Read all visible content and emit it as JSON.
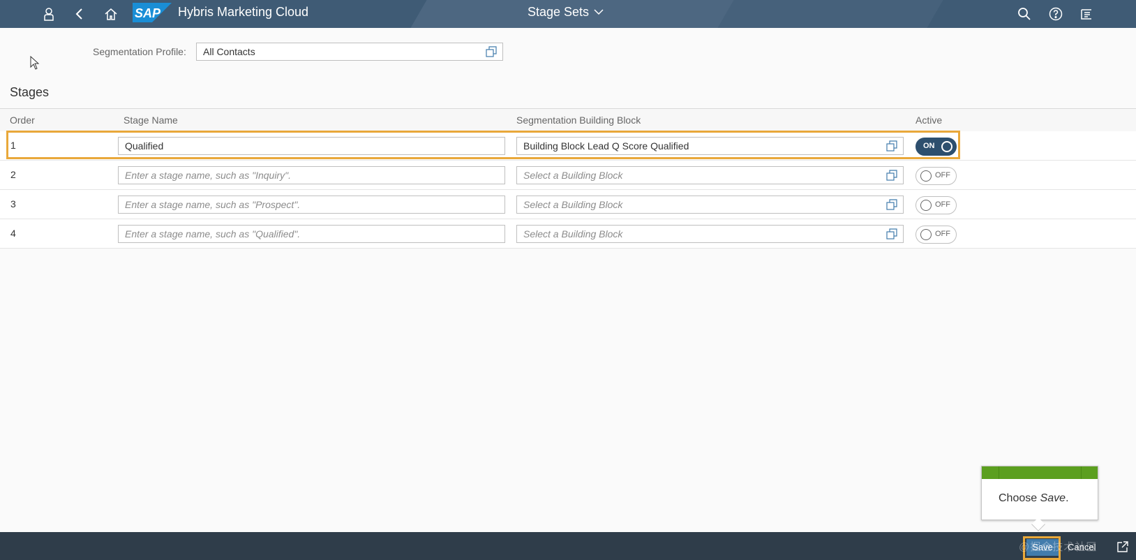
{
  "shell": {
    "app_title": "Hybris Marketing Cloud",
    "logo_text": "SAP",
    "page_title": "Stage Sets"
  },
  "segmentation": {
    "label": "Segmentation Profile:",
    "value": "All Contacts"
  },
  "stages": {
    "title": "Stages",
    "columns": [
      "Order",
      "Stage Name",
      "Segmentation Building Block",
      "Active"
    ],
    "rows": [
      {
        "order": "1",
        "name": "Qualified",
        "name_placeholder": "",
        "building_block": "Building Block Lead Q Score Qualified",
        "bb_placeholder": "",
        "active": "ON"
      },
      {
        "order": "2",
        "name": "",
        "name_placeholder": "Enter a stage name, such as \"Inquiry\".",
        "building_block": "",
        "bb_placeholder": "Select a Building Block",
        "active": "OFF"
      },
      {
        "order": "3",
        "name": "",
        "name_placeholder": "Enter a stage name, such as \"Prospect\".",
        "building_block": "",
        "bb_placeholder": "Select a Building Block",
        "active": "OFF"
      },
      {
        "order": "4",
        "name": "",
        "name_placeholder": "Enter a stage name, such as \"Qualified\".",
        "building_block": "",
        "bb_placeholder": "Select a Building Block",
        "active": "OFF"
      }
    ]
  },
  "footer": {
    "save_label": "Save",
    "cancel_label": "Cancel",
    "watermark": "@掘金技术社区"
  },
  "tooltip": {
    "prefix": "Choose ",
    "emphasis": "Save",
    "suffix": "."
  },
  "colors": {
    "shell": "#3f5b75",
    "highlight": "#e9a83a",
    "toggle_on": "#2d4f6e",
    "tooltip_bar": "#5b9f1f",
    "footer": "#2f3d4a"
  }
}
